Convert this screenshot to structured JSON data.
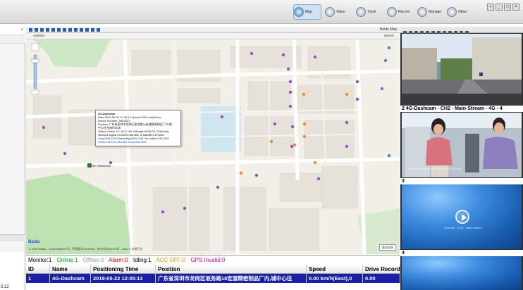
{
  "topnav": {
    "items": [
      {
        "label": "Map",
        "icon": "map-icon",
        "active": true
      },
      {
        "label": "Video",
        "icon": "video-icon",
        "active": false
      },
      {
        "label": "Track",
        "icon": "track-icon",
        "active": false
      },
      {
        "label": "Record",
        "icon": "record-icon",
        "active": false
      },
      {
        "label": "Manage",
        "icon": "manage-icon",
        "active": false
      },
      {
        "label": "Other",
        "icon": "other-icon",
        "active": false
      }
    ]
  },
  "map": {
    "header_left": "Address",
    "header_right": "Search",
    "toolbar_right": "Baidu Map",
    "vehicle_label": "4G-Dashcam",
    "popup": {
      "title": "4G-Dashcam",
      "line1": "Date:2019-05-22 12:45:13     Speed:0.00 km/h(East)",
      "line2": "Device Number: 9654321",
      "line3": "Position:广东省深圳市龙岗区坂务路18宏渡精密制品厂内,城",
      "line4": "中心往东南约95米",
      "line5": "Status:Online, IO, ACC ON, Mileage:00:00:00, SD(Exist),",
      "line6": "Network signal excellent,Number of satellites:8,Video",
      "line7": "Loss:CH1,CH2,Recording:CH1,CH2, No video:CH3,CH4",
      "line8": "Video  Intercom  Monitor  Snapshot  More"
    },
    "logo": "Baidu",
    "copyright": "© 2019 Baidu - GS(2018)5572号 - 甲测资字1100930 - 京ICP证030173号 - Data © 长地万方",
    "road_button": "路况信息"
  },
  "video_panel": {
    "channels": [
      {
        "label": "2 4G-Dashcam - CH2 - Main-Stream - 4G - 4",
        "osd": "GPS:114.135,22.657  2019-05-22 12:45:12",
        "watermark": ""
      },
      {
        "label": "3",
        "osd": "",
        "watermark": "TeamGD - CH3 - Main-Stream"
      },
      {
        "label": "4",
        "osd": "",
        "watermark": ""
      }
    ]
  },
  "status": {
    "monitor": "Monitor:1",
    "online": "Online:1",
    "offline": "Offline:0",
    "alarm": "Alarm:0",
    "idling": "Idling:1",
    "acc_off": "ACC OFF:0",
    "gps_invalid": "GPS Invalid:0",
    "colors": {
      "monitor": "#000000",
      "online": "#009900",
      "offline": "#999999",
      "alarm": "#e00000",
      "idling": "#000000",
      "acc_off": "#d89a00",
      "gps_invalid": "#d400d4"
    }
  },
  "table": {
    "columns": [
      "ID",
      "Name",
      "Positioning Time",
      "Position",
      "Speed",
      "Drive Record"
    ],
    "rows": [
      {
        "id": "1",
        "name": "4G-Dashcam",
        "time": "2019-05-22 12:45:13",
        "position": "广东省深圳市龙岗区坂务路18宏渡精密制品厂内,城中心往",
        "speed": "0.00 km/h(East),0",
        "drive_record": "0.00"
      }
    ]
  },
  "left_panel": {
    "bottom_text": "5:12"
  }
}
